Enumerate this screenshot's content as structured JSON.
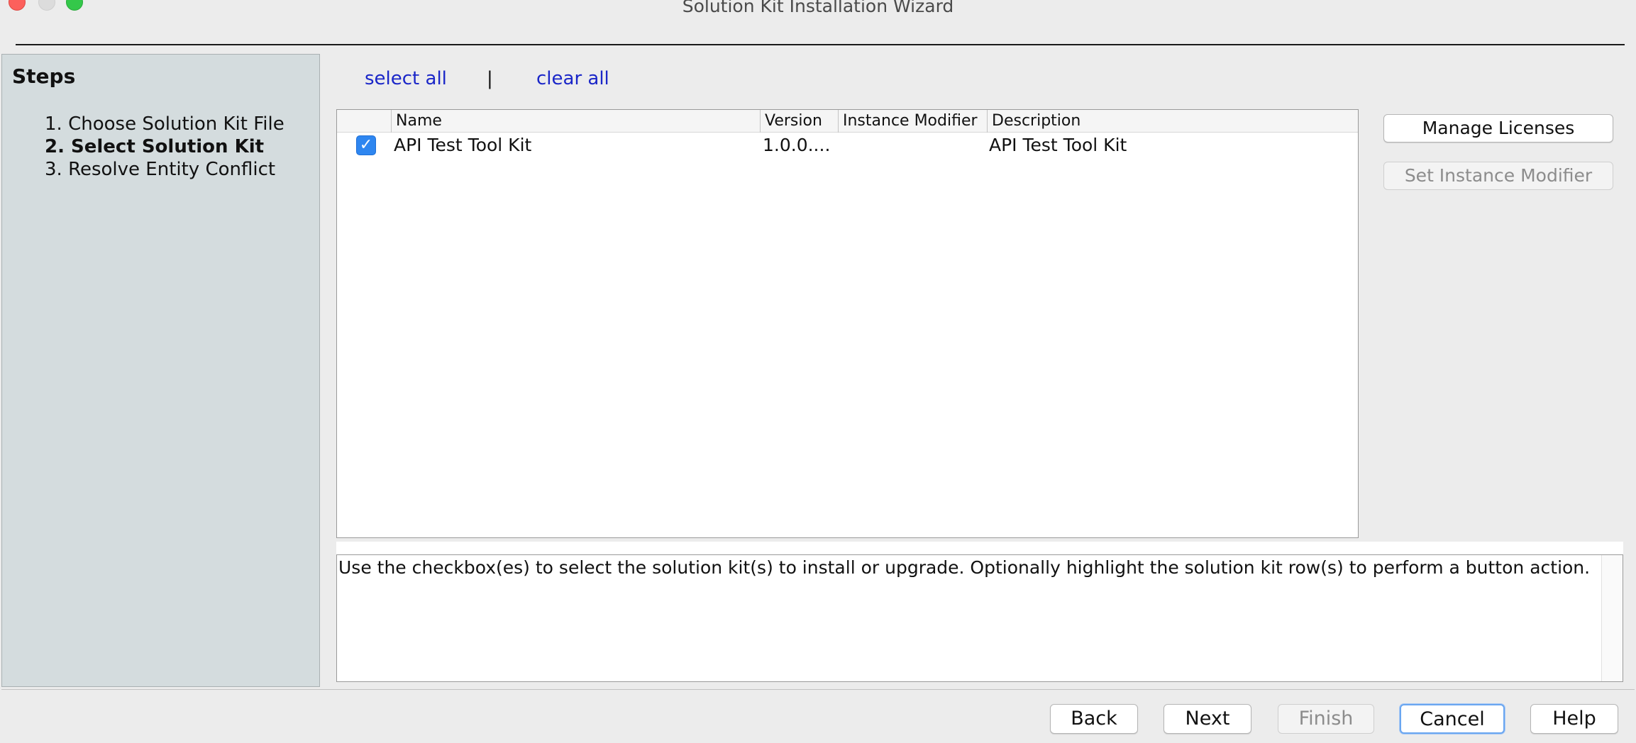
{
  "window": {
    "title": "Solution Kit Installation Wizard"
  },
  "steps": {
    "title": "Steps",
    "items": [
      {
        "label": "1. Choose Solution Kit File",
        "current": false
      },
      {
        "label": "2. Select Solution Kit",
        "current": true
      },
      {
        "label": "3. Resolve Entity Conflict",
        "current": false
      }
    ]
  },
  "links": {
    "select_all": "select all",
    "separator": "|",
    "clear_all": "clear all"
  },
  "table": {
    "columns": [
      "Name",
      "Version",
      "Instance Modifier",
      "Description"
    ],
    "rows": [
      {
        "checked": true,
        "name": "API Test Tool Kit",
        "version": "1.0.0....",
        "instance_modifier": "",
        "description": "API Test Tool Kit"
      }
    ]
  },
  "side_buttons": {
    "manage_licenses": "Manage Licenses",
    "set_instance_modifier": "Set Instance Modifier"
  },
  "description_text": "Use the checkbox(es) to select the solution kit(s) to install or upgrade. Optionally highlight the solution kit row(s) to perform a button action.",
  "buttons": {
    "back": "Back",
    "next": "Next",
    "finish": "Finish",
    "cancel": "Cancel",
    "help": "Help"
  },
  "colors": {
    "link": "#1a26c8",
    "steps_panel": "#d4dcde",
    "checkbox": "#2e86f0"
  }
}
